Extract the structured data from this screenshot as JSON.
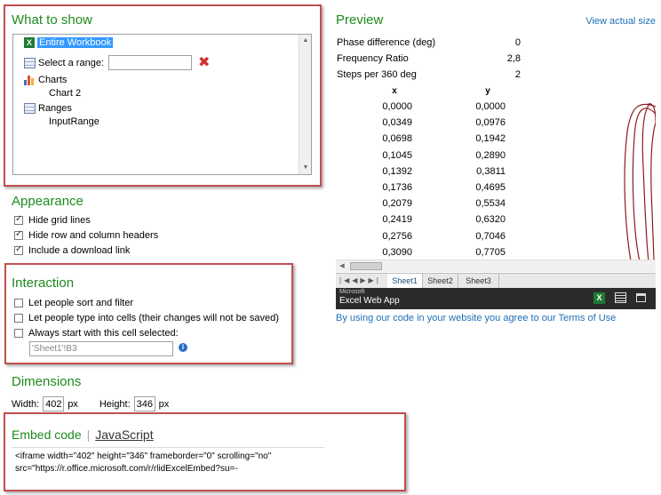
{
  "what_to_show": {
    "title": "What to show",
    "items": {
      "entire_workbook": "Entire Workbook",
      "select_range": "Select a range:",
      "charts": "Charts",
      "chart2": "Chart 2",
      "ranges": "Ranges",
      "input_range": "InputRange"
    },
    "range_value": ""
  },
  "appearance": {
    "title": "Appearance",
    "options": [
      {
        "label": "Hide grid lines",
        "checked": true
      },
      {
        "label": "Hide row and column headers",
        "checked": true
      },
      {
        "label": "Include a download link",
        "checked": true
      }
    ]
  },
  "interaction": {
    "title": "Interaction",
    "options": [
      {
        "label": "Let people sort and filter",
        "checked": false
      },
      {
        "label": "Let people type into cells (their changes will not be saved)",
        "checked": false
      },
      {
        "label": "Always start with this cell selected:",
        "checked": false
      }
    ],
    "cell_value": "'Sheet1'!B3"
  },
  "dimensions": {
    "title": "Dimensions",
    "width_label": "Width:",
    "width_value": "402",
    "height_label": "Height:",
    "height_value": "346",
    "unit": "px"
  },
  "embed": {
    "tab_active": "Embed code",
    "tab_other": "JavaScript",
    "code_line1": "<iframe width=\"402\" height=\"346\" frameborder=\"0\" scrolling=\"no\"",
    "code_line2": "src=\"https://r.office.microsoft.com/r/rlidExcelEmbed?su=-"
  },
  "preview": {
    "title": "Preview",
    "view_actual": "View actual size",
    "params": [
      {
        "label": "Phase difference (deg)",
        "value": "0"
      },
      {
        "label": "Frequency Ratio",
        "value": "2,8"
      },
      {
        "label": "Steps per 360 deg",
        "value": "2"
      }
    ],
    "col_x": "x",
    "col_y": "y",
    "rows": [
      [
        "0,0000",
        "0,0000"
      ],
      [
        "0,0349",
        "0,0976"
      ],
      [
        "0,0698",
        "0,1942"
      ],
      [
        "0,1045",
        "0,2890"
      ],
      [
        "0,1392",
        "0,3811"
      ],
      [
        "0,1736",
        "0,4695"
      ],
      [
        "0,2079",
        "0,5534"
      ],
      [
        "0,2419",
        "0,6320"
      ],
      [
        "0,2756",
        "0,7046"
      ],
      [
        "0,3090",
        "0,7705"
      ]
    ],
    "sheets": [
      "Sheet1",
      "Sheet2",
      "Sheet3"
    ],
    "ewa_brand_small": "Microsoft",
    "ewa_brand": "Excel Web App",
    "terms": "By using our code in your website you agree to our Terms of Use"
  },
  "colors": {
    "heading_green": "#1e8a1e",
    "frame_red": "#c0504d",
    "link_blue": "#1f6fb5"
  }
}
